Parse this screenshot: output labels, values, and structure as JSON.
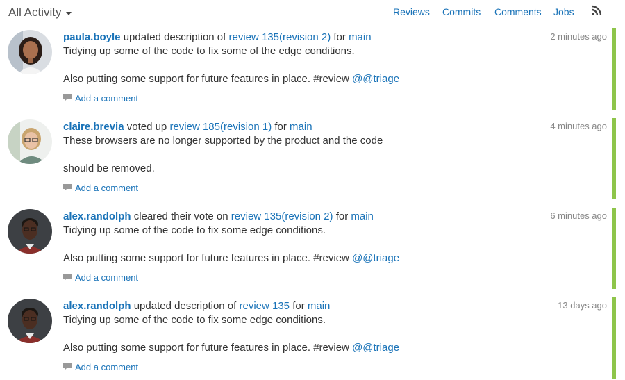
{
  "header": {
    "title": "All Activity",
    "nav": [
      "Reviews",
      "Commits",
      "Comments",
      "Jobs"
    ]
  },
  "colors": {
    "accent": "#1a73b8",
    "status_bar": "#8ec54a",
    "timestamp": "#888888"
  },
  "entries": [
    {
      "user": "paula.boyle",
      "action": " updated description of ",
      "target": "review 135",
      "revision": "(revision 2)",
      "for_text": " for ",
      "branch": "main",
      "time": "2 minutes ago",
      "line1": "Tidying up some of the code to fix some of the edge conditions.",
      "line2": "Also putting some support for future features in place. #review ",
      "mention": "@@triage",
      "comment_label": "Add a comment",
      "avatar": "woman-dark-hair-icon"
    },
    {
      "user": "claire.brevia",
      "action": " voted up ",
      "target": "review 185",
      "revision": "(revision 1)",
      "for_text": " for ",
      "branch": "main",
      "time": "4 minutes ago",
      "line1": "These browsers are no longer supported by the product and the code",
      "line2": "should be removed.",
      "mention": "",
      "comment_label": "Add a comment",
      "avatar": "woman-glasses-icon"
    },
    {
      "user": "alex.randolph",
      "action": " cleared their vote on ",
      "target": "review 135",
      "revision": "(revision 2)",
      "for_text": " for ",
      "branch": "main",
      "time": "6 minutes ago",
      "line1": "Tidying up some of the code to fix some edge conditions.",
      "line2": "Also putting some support for future features in place. #review ",
      "mention": "@@triage",
      "comment_label": "Add a comment",
      "avatar": "man-dark-icon"
    },
    {
      "user": "alex.randolph",
      "action": " updated description of ",
      "target": "review 135",
      "revision": "",
      "for_text": " for ",
      "branch": "main",
      "time": "13 days ago",
      "line1": "Tidying up some of the code to fix some edge conditions.",
      "line2": "Also putting some support for future features in place. #review ",
      "mention": "@@triage",
      "comment_label": "Add a comment",
      "avatar": "man-dark-icon"
    }
  ]
}
